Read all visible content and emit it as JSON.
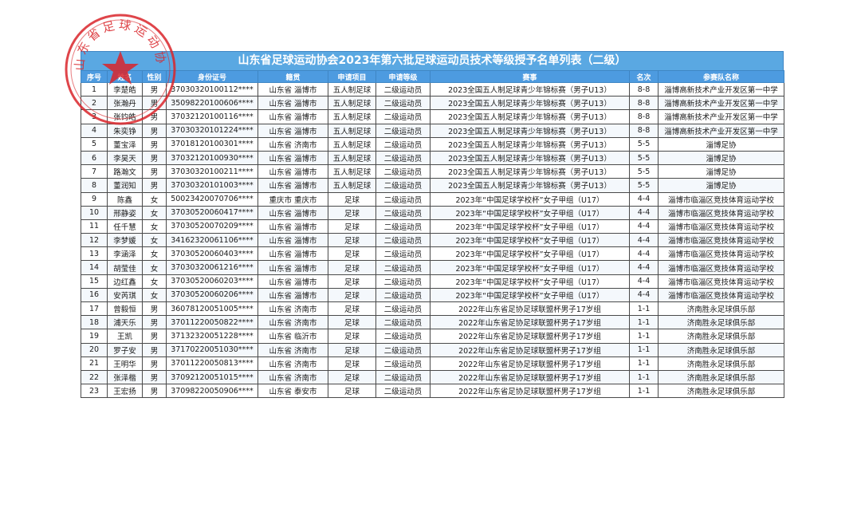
{
  "title": "山东省足球运动协会2023年第六批足球运动员技术等级授予名单列表（二级）",
  "seal": {
    "text": "山东省足球运动协会",
    "color": "#d9252a"
  },
  "columns": [
    "序号",
    "姓名",
    "性别",
    "身份证号",
    "籍贯",
    "申请项目",
    "申请等级",
    "赛事",
    "名次",
    "参赛队名称"
  ],
  "rows": [
    [
      "1",
      "李楚皓",
      "男",
      "37030320100112****",
      "山东省 淄博市",
      "五人制足球",
      "二级运动员",
      "2023全国五人制足球青少年锦标赛（男子U13）",
      "8-8",
      "淄博高新技术产业开发区第一中学"
    ],
    [
      "2",
      "张瀚丹",
      "男",
      "35098220100606****",
      "山东省 淄博市",
      "五人制足球",
      "二级运动员",
      "2023全国五人制足球青少年锦标赛（男子U13）",
      "8-8",
      "淄博高新技术产业开发区第一中学"
    ],
    [
      "3",
      "张钧皓",
      "男",
      "37032120100116****",
      "山东省 淄博市",
      "五人制足球",
      "二级运动员",
      "2023全国五人制足球青少年锦标赛（男子U13）",
      "8-8",
      "淄博高新技术产业开发区第一中学"
    ],
    [
      "4",
      "朱奕铮",
      "男",
      "37030320101224****",
      "山东省 淄博市",
      "五人制足球",
      "二级运动员",
      "2023全国五人制足球青少年锦标赛（男子U13）",
      "8-8",
      "淄博高新技术产业开发区第一中学"
    ],
    [
      "5",
      "董宝泽",
      "男",
      "37018120100301****",
      "山东省 济南市",
      "五人制足球",
      "二级运动员",
      "2023全国五人制足球青少年锦标赛（男子U13）",
      "5-5",
      "淄博足协"
    ],
    [
      "6",
      "李昊天",
      "男",
      "37032120100930****",
      "山东省 淄博市",
      "五人制足球",
      "二级运动员",
      "2023全国五人制足球青少年锦标赛（男子U13）",
      "5-5",
      "淄博足协"
    ],
    [
      "7",
      "路瀚文",
      "男",
      "37030320100211****",
      "山东省 淄博市",
      "五人制足球",
      "二级运动员",
      "2023全国五人制足球青少年锦标赛（男子U13）",
      "5-5",
      "淄博足协"
    ],
    [
      "8",
      "董润知",
      "男",
      "37030320101003****",
      "山东省 淄博市",
      "五人制足球",
      "二级运动员",
      "2023全国五人制足球青少年锦标赛（男子U13）",
      "5-5",
      "淄博足协"
    ],
    [
      "9",
      "陈鑫",
      "女",
      "50023420070706****",
      "重庆市 重庆市",
      "足球",
      "二级运动员",
      "2023年“中国足球学校杯”女子甲组（U17）",
      "4-4",
      "淄博市临淄区竞技体育运动学校"
    ],
    [
      "10",
      "邢静姿",
      "女",
      "37030520060417****",
      "山东省 淄博市",
      "足球",
      "二级运动员",
      "2023年“中国足球学校杯”女子甲组（U17）",
      "4-4",
      "淄博市临淄区竞技体育运动学校"
    ],
    [
      "11",
      "任千慧",
      "女",
      "37030520070209****",
      "山东省 淄博市",
      "足球",
      "二级运动员",
      "2023年“中国足球学校杯”女子甲组（U17）",
      "4-4",
      "淄博市临淄区竞技体育运动学校"
    ],
    [
      "12",
      "李梦媛",
      "女",
      "34162320061106****",
      "山东省 淄博市",
      "足球",
      "二级运动员",
      "2023年“中国足球学校杯”女子甲组（U17）",
      "4-4",
      "淄博市临淄区竞技体育运动学校"
    ],
    [
      "13",
      "李涵泽",
      "女",
      "37030520060403****",
      "山东省 淄博市",
      "足球",
      "二级运动员",
      "2023年“中国足球学校杯”女子甲组（U17）",
      "4-4",
      "淄博市临淄区竞技体育运动学校"
    ],
    [
      "14",
      "胡莹佳",
      "女",
      "37030320061216****",
      "山东省 淄博市",
      "足球",
      "二级运动员",
      "2023年“中国足球学校杯”女子甲组（U17）",
      "4-4",
      "淄博市临淄区竞技体育运动学校"
    ],
    [
      "15",
      "边红鑫",
      "女",
      "37030520060203****",
      "山东省 淄博市",
      "足球",
      "二级运动员",
      "2023年“中国足球学校杯”女子甲组（U17）",
      "4-4",
      "淄博市临淄区竞技体育运动学校"
    ],
    [
      "16",
      "安芮琪",
      "女",
      "37030520060206****",
      "山东省 淄博市",
      "足球",
      "二级运动员",
      "2023年“中国足球学校杯”女子甲组（U17）",
      "4-4",
      "淄博市临淄区竞技体育运动学校"
    ],
    [
      "17",
      "曾毅恒",
      "男",
      "36078120051005****",
      "山东省 济南市",
      "足球",
      "二级运动员",
      "2022年山东省足协足球联盟杯男子17岁组",
      "1-1",
      "济南胜永足球俱乐部"
    ],
    [
      "18",
      "浦天乐",
      "男",
      "37011220050822****",
      "山东省 济南市",
      "足球",
      "二级运动员",
      "2022年山东省足协足球联盟杯男子17岁组",
      "1-1",
      "济南胜永足球俱乐部"
    ],
    [
      "19",
      "王凯",
      "男",
      "37132320051228****",
      "山东省 临沂市",
      "足球",
      "二级运动员",
      "2022年山东省足协足球联盟杯男子17岁组",
      "1-1",
      "济南胜永足球俱乐部"
    ],
    [
      "20",
      "罗子安",
      "男",
      "37170220051030****",
      "山东省 济南市",
      "足球",
      "二级运动员",
      "2022年山东省足协足球联盟杯男子17岁组",
      "1-1",
      "济南胜永足球俱乐部"
    ],
    [
      "21",
      "王明华",
      "男",
      "37011220050813****",
      "山东省 济南市",
      "足球",
      "二级运动员",
      "2022年山东省足协足球联盟杯男子17岁组",
      "1-1",
      "济南胜永足球俱乐部"
    ],
    [
      "22",
      "张泽楷",
      "男",
      "37092120051015****",
      "山东省 济南市",
      "足球",
      "二级运动员",
      "2022年山东省足协足球联盟杯男子17岁组",
      "1-1",
      "济南胜永足球俱乐部"
    ],
    [
      "23",
      "王宏扬",
      "男",
      "37098220050906****",
      "山东省 泰安市",
      "足球",
      "二级运动员",
      "2022年山东省足协足球联盟杯男子17岁组",
      "1-1",
      "济南胜永足球俱乐部"
    ]
  ]
}
